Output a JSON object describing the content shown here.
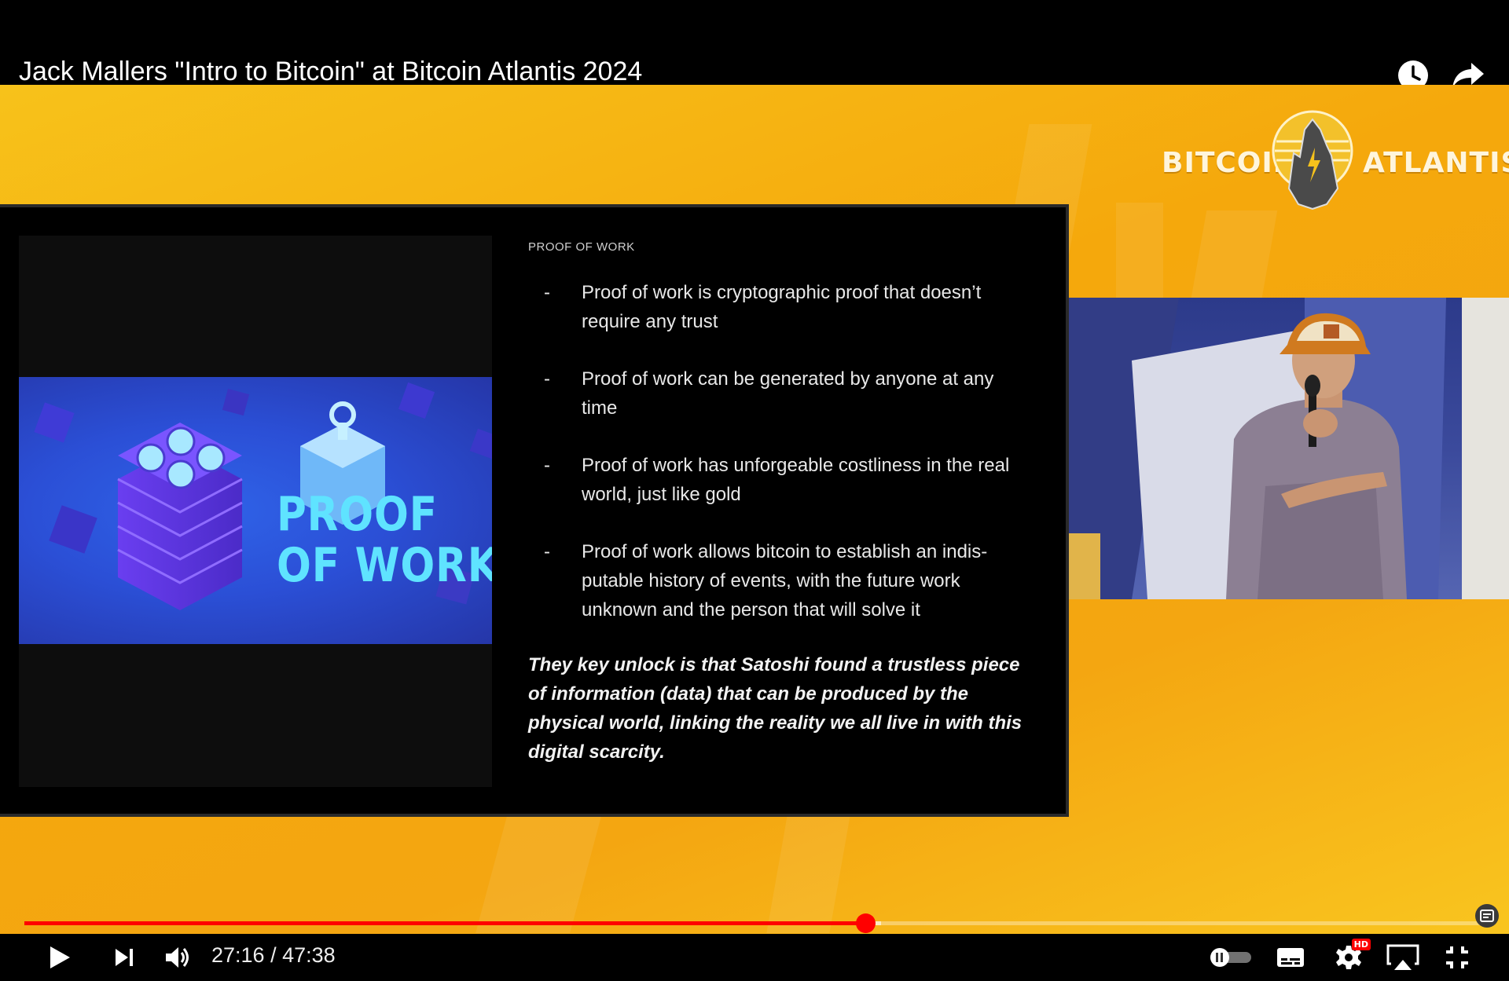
{
  "header": {
    "title": "Jack Mallers \"Intro to Bitcoin\" at Bitcoin Atlantis 2024",
    "icons": [
      "watch-later-icon",
      "share-icon"
    ]
  },
  "brand": {
    "left_word": "BITCOIN",
    "right_word": "ATLANTIS"
  },
  "slide": {
    "heading": "PROOF OF WORK",
    "image_text_line1": "PROOF",
    "image_text_line2": "OF WORK",
    "bullets": [
      {
        "dash": "-",
        "text": "Proof of work is cryptographic proof that doesn’t require any trust"
      },
      {
        "dash": "-",
        "text": "Proof of work can be generated by anyone at any time"
      },
      {
        "dash": "-",
        "text": "Proof of work has unforgeable costliness in the real world, just like gold"
      },
      {
        "dash": "-",
        "text": "Proof of work allows bitcoin to establish an indis-putable history of events, with the future work unknown and the person that will solve it"
      }
    ],
    "quote": "They key unlock is that Satoshi found a trustless piece of information (data) that can be produced by the physical world, linking the reality we all live in with this digital scarcity."
  },
  "player": {
    "current_time": "27:16",
    "separator": " / ",
    "duration": "47:38",
    "played_fraction": 0.5757,
    "buffered_fraction": 0.5865,
    "hd_label": "HD",
    "accent": "#ff0000"
  }
}
